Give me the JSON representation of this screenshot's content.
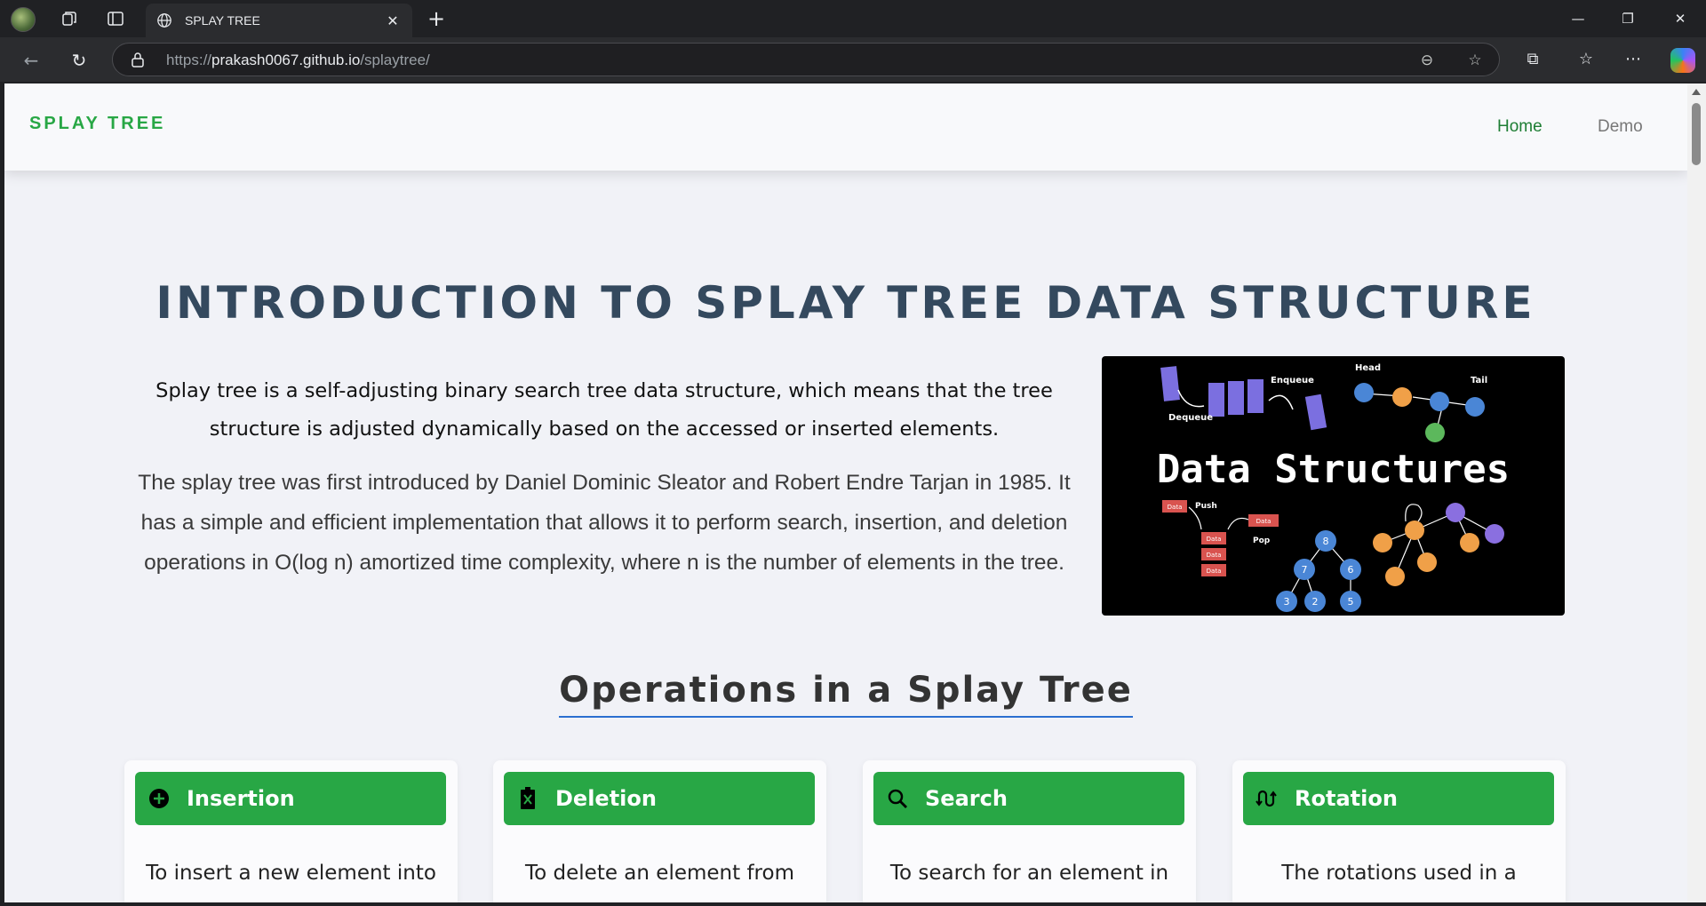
{
  "browser": {
    "tab_title": "SPLAY TREE",
    "url_prefix": "https://",
    "url_host": "prakash0067.github.io",
    "url_path": "/splaytree/"
  },
  "site": {
    "brand": "SPLAY TREE",
    "nav": [
      "Home",
      "Demo"
    ],
    "accent_color": "#28a745"
  },
  "hero": {
    "title": "INTRODUCTION TO SPLAY TREE DATA STRUCTURE",
    "lead": "Splay tree is a self-adjusting binary search tree data structure, which means that the tree structure is adjusted dynamically based on the accessed or inserted elements.",
    "body": "The splay tree was first introduced by Daniel Dominic Sleator and Robert Endre Tarjan in 1985. It has a simple and efficient implementation that allows it to perform search, insertion, and deletion operations in O(log n) amortized time complexity, where n is the number of elements in the tree."
  },
  "image": {
    "caption": "Data Structures",
    "labels": {
      "dequeue": "Dequeue",
      "enqueue": "Enqueue",
      "head": "Head",
      "tail": "Tail",
      "push": "Push",
      "pop": "Pop",
      "data": "Data"
    },
    "tree_nodes": [
      "8",
      "7",
      "6",
      "3",
      "2",
      "5"
    ]
  },
  "operations": {
    "title": "Operations in a Splay Tree",
    "cards": [
      {
        "label": "Insertion",
        "icon": "plus-circle-icon",
        "text": "To insert a new element into"
      },
      {
        "label": "Deletion",
        "icon": "trash-icon",
        "text": "To delete an element from"
      },
      {
        "label": "Search",
        "icon": "search-icon",
        "text": "To search for an element in"
      },
      {
        "label": "Rotation",
        "icon": "rotation-icon",
        "text": "The rotations used in a"
      }
    ]
  }
}
